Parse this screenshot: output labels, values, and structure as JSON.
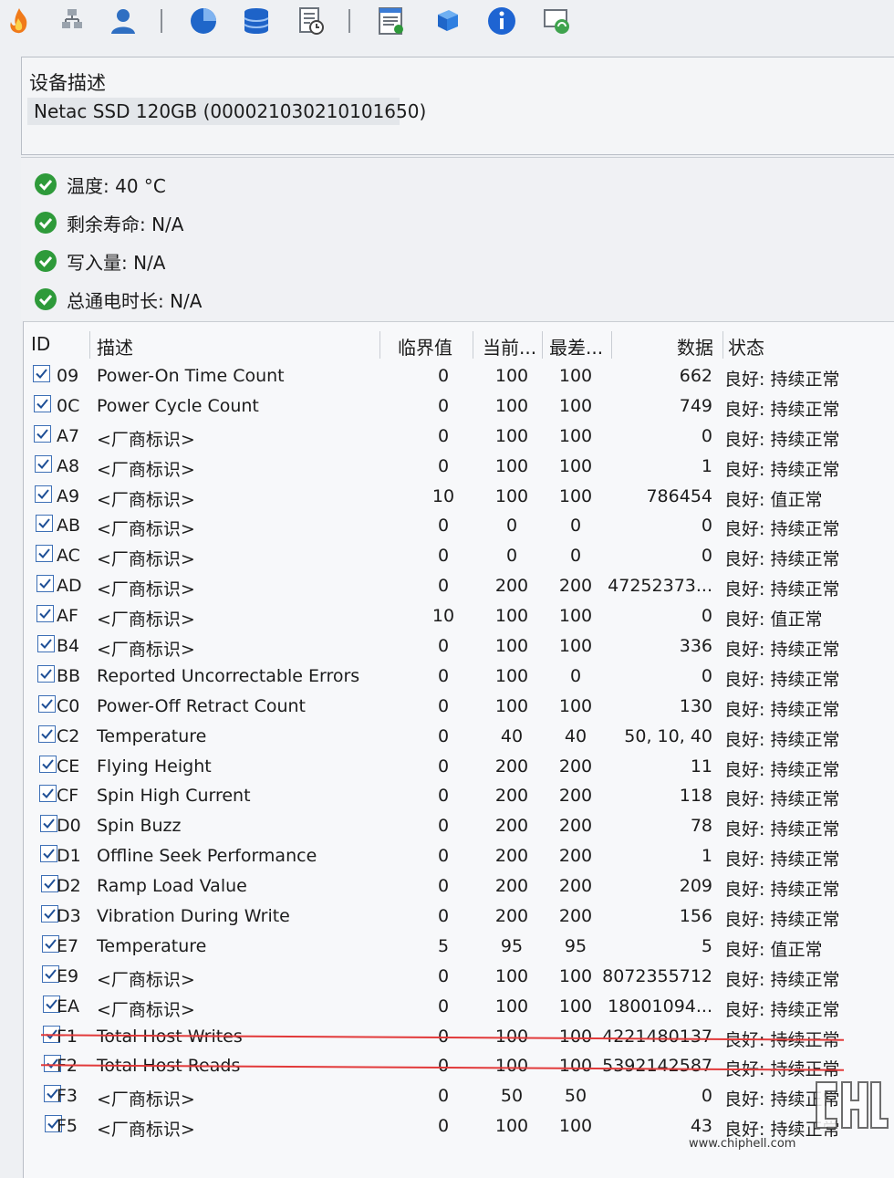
{
  "device": {
    "section_title": "设备描述",
    "name": "Netac SSD 120GB (000021030210101650)"
  },
  "status": [
    {
      "text": "温度: 40 °C"
    },
    {
      "text": "剩余寿命: N/A"
    },
    {
      "text": "写入量: N/A"
    },
    {
      "text": "总通电时长: N/A"
    }
  ],
  "table": {
    "headers": {
      "id": "ID",
      "desc": "描述",
      "threshold": "临界值",
      "current": "当前...",
      "worst": "最差...",
      "data": "数据",
      "status": "状态"
    },
    "rows": [
      {
        "id": "09",
        "desc": "Power-On Time Count",
        "thr": "0",
        "cur": "100",
        "worst": "100",
        "data": "662",
        "status": "良好:  持续正常"
      },
      {
        "id": "0C",
        "desc": "Power Cycle Count",
        "thr": "0",
        "cur": "100",
        "worst": "100",
        "data": "749",
        "status": "良好:  持续正常"
      },
      {
        "id": "A7",
        "desc": "<厂商标识>",
        "thr": "0",
        "cur": "100",
        "worst": "100",
        "data": "0",
        "status": "良好:  持续正常"
      },
      {
        "id": "A8",
        "desc": "<厂商标识>",
        "thr": "0",
        "cur": "100",
        "worst": "100",
        "data": "1",
        "status": "良好:  持续正常"
      },
      {
        "id": "A9",
        "desc": "<厂商标识>",
        "thr": "10",
        "cur": "100",
        "worst": "100",
        "data": "786454",
        "status": "良好:  值正常"
      },
      {
        "id": "AB",
        "desc": "<厂商标识>",
        "thr": "0",
        "cur": "0",
        "worst": "0",
        "data": "0",
        "status": "良好:  持续正常"
      },
      {
        "id": "AC",
        "desc": "<厂商标识>",
        "thr": "0",
        "cur": "0",
        "worst": "0",
        "data": "0",
        "status": "良好:  持续正常"
      },
      {
        "id": "AD",
        "desc": "<厂商标识>",
        "thr": "0",
        "cur": "200",
        "worst": "200",
        "data": "47252373...",
        "status": "良好:  持续正常"
      },
      {
        "id": "AF",
        "desc": "<厂商标识>",
        "thr": "10",
        "cur": "100",
        "worst": "100",
        "data": "0",
        "status": "良好:  值正常"
      },
      {
        "id": "B4",
        "desc": "<厂商标识>",
        "thr": "0",
        "cur": "100",
        "worst": "100",
        "data": "336",
        "status": "良好:  持续正常"
      },
      {
        "id": "BB",
        "desc": "Reported Uncorrectable Errors",
        "thr": "0",
        "cur": "100",
        "worst": "0",
        "data": "0",
        "status": "良好:  持续正常"
      },
      {
        "id": "C0",
        "desc": "Power-Off Retract Count",
        "thr": "0",
        "cur": "100",
        "worst": "100",
        "data": "130",
        "status": "良好:  持续正常"
      },
      {
        "id": "C2",
        "desc": "Temperature",
        "thr": "0",
        "cur": "40",
        "worst": "40",
        "data": "50, 10, 40",
        "status": "良好:  持续正常"
      },
      {
        "id": "CE",
        "desc": "Flying Height",
        "thr": "0",
        "cur": "200",
        "worst": "200",
        "data": "11",
        "status": "良好:  持续正常"
      },
      {
        "id": "CF",
        "desc": "Spin High Current",
        "thr": "0",
        "cur": "200",
        "worst": "200",
        "data": "118",
        "status": "良好:  持续正常"
      },
      {
        "id": "D0",
        "desc": "Spin Buzz",
        "thr": "0",
        "cur": "200",
        "worst": "200",
        "data": "78",
        "status": "良好:  持续正常"
      },
      {
        "id": "D1",
        "desc": "Offline Seek Performance",
        "thr": "0",
        "cur": "200",
        "worst": "200",
        "data": "1",
        "status": "良好:  持续正常"
      },
      {
        "id": "D2",
        "desc": "Ramp Load Value",
        "thr": "0",
        "cur": "200",
        "worst": "200",
        "data": "209",
        "status": "良好:  持续正常"
      },
      {
        "id": "D3",
        "desc": "Vibration During Write",
        "thr": "0",
        "cur": "200",
        "worst": "200",
        "data": "156",
        "status": "良好:  持续正常"
      },
      {
        "id": "E7",
        "desc": "Temperature",
        "thr": "5",
        "cur": "95",
        "worst": "95",
        "data": "5",
        "status": "良好:  值正常"
      },
      {
        "id": "E9",
        "desc": "<厂商标识>",
        "thr": "0",
        "cur": "100",
        "worst": "100",
        "data": "8072355712",
        "status": "良好:  持续正常"
      },
      {
        "id": "EA",
        "desc": "<厂商标识>",
        "thr": "0",
        "cur": "100",
        "worst": "100",
        "data": "18001094...",
        "status": "良好:  持续正常"
      },
      {
        "id": "F1",
        "desc": "Total Host Writes",
        "thr": "0",
        "cur": "100",
        "worst": "100",
        "data": "4221480137",
        "status": "良好:  持续正常"
      },
      {
        "id": "F2",
        "desc": "Total Host Reads",
        "thr": "0",
        "cur": "100",
        "worst": "100",
        "data": "5392142587",
        "status": "良好:  持续正常"
      },
      {
        "id": "F3",
        "desc": "<厂商标识>",
        "thr": "0",
        "cur": "50",
        "worst": "50",
        "data": "0",
        "status": "良好:  持续正常"
      },
      {
        "id": "F5",
        "desc": "<厂商标识>",
        "thr": "0",
        "cur": "100",
        "worst": "100",
        "data": "43",
        "status": "良好:  持续正常"
      }
    ]
  },
  "watermark": {
    "url": "www.chiphell.com"
  },
  "colors": {
    "ok_green": "#2e9a3a",
    "red_underline": "#e23a3a",
    "check_blue": "#3d6fb6"
  }
}
